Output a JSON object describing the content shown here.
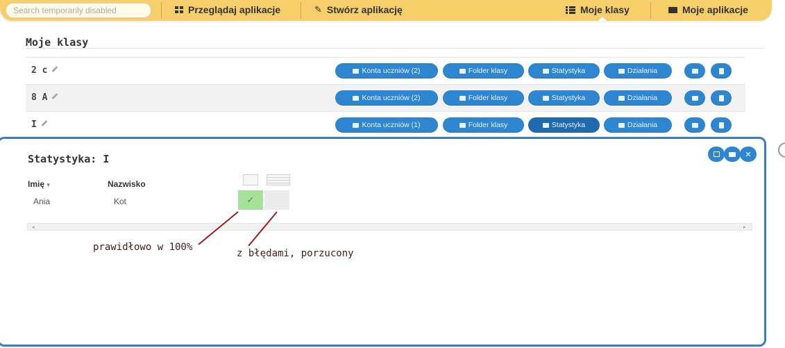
{
  "topbar": {
    "search_placeholder": "Search temporarily disabled",
    "nav_browse": "Przeglądaj aplikacje",
    "nav_create": "Stwórz aplikację",
    "nav_my_classes": "Moje klasy",
    "nav_my_apps": "Moje aplikacje"
  },
  "section_title": "Moje klasy",
  "classes": [
    {
      "name": "2 c",
      "accounts": "Konta uczniów (2)",
      "folder": "Folder klasy",
      "stats": "Statystyka",
      "actions": "Działania"
    },
    {
      "name": "8 A",
      "accounts": "Konta uczniów (2)",
      "folder": "Folder klasy",
      "stats": "Statystyka",
      "actions": "Działania"
    },
    {
      "name": "I",
      "accounts": "Konta uczniów (1)",
      "folder": "Folder klasy",
      "stats": "Statystyka",
      "actions": "Działania"
    }
  ],
  "stats_panel": {
    "title": "Statystyka: I",
    "col_first": "Imię",
    "col_first_sort": "▾",
    "col_last": "Nazwisko",
    "student_first": "Ania",
    "student_last": "Kot",
    "ok_mark": "✓"
  },
  "annotations": {
    "correct": "prawidłowo w 100%",
    "errors": "z błędami, porzucony"
  },
  "colors": {
    "topbar": "#f6cf6b",
    "button": "#2f86d0",
    "panel_border": "#3a7dc2",
    "correct_cell": "#a6e19b",
    "annotation_arrow": "#a01c1c"
  }
}
